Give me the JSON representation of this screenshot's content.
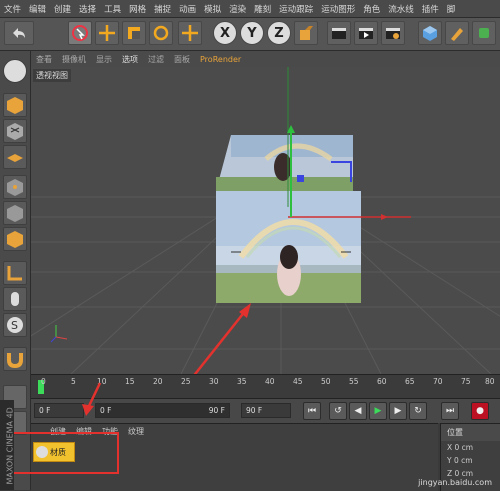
{
  "menu": [
    "文件",
    "编辑",
    "创建",
    "选择",
    "工具",
    "网格",
    "捕捉",
    "动画",
    "模拟",
    "渲染",
    "雕刻",
    "运动跟踪",
    "运动图形",
    "角色",
    "流水线",
    "插件",
    "脚"
  ],
  "toolbar": {
    "axes": [
      "X",
      "Y",
      "Z"
    ],
    "icons": [
      "undo-icon",
      "select-icon",
      "move-icon",
      "scale-icon",
      "rotate-icon",
      "move-axis-icon",
      "x-axis-icon",
      "y-axis-icon",
      "z-axis-icon",
      "coordinate-icon",
      "render-region-icon",
      "render-view-icon",
      "render-settings-icon",
      "cube-icon",
      "pen-icon",
      "spline-icon"
    ]
  },
  "viewport": {
    "menu": [
      "查看",
      "摄像机",
      "显示",
      "选项",
      "过滤",
      "面板",
      "ProRender"
    ],
    "label": "透视视图"
  },
  "timeline": {
    "ticks": [
      "0",
      "5",
      "10",
      "15",
      "20",
      "25",
      "30",
      "35",
      "40",
      "45",
      "50",
      "55",
      "60",
      "65",
      "70",
      "75",
      "80"
    ],
    "current_frame": 0
  },
  "frames": {
    "start": "0 F",
    "current": "0 F",
    "end_range": "90 F",
    "end": "90 F"
  },
  "material_panel": {
    "menu": [
      "创建",
      "编辑",
      "功能",
      "纹理"
    ],
    "material_name": "材质"
  },
  "position_panel": {
    "title": "位置",
    "rows": [
      {
        "axis": "X",
        "value": "0 cm"
      },
      {
        "axis": "Y",
        "value": "0 cm"
      },
      {
        "axis": "Z",
        "value": "0 cm"
      }
    ]
  },
  "brand": "MAXON CINEMA 4D",
  "watermark": "jingyan.baidu.com",
  "annotation_color": "#e3322e"
}
